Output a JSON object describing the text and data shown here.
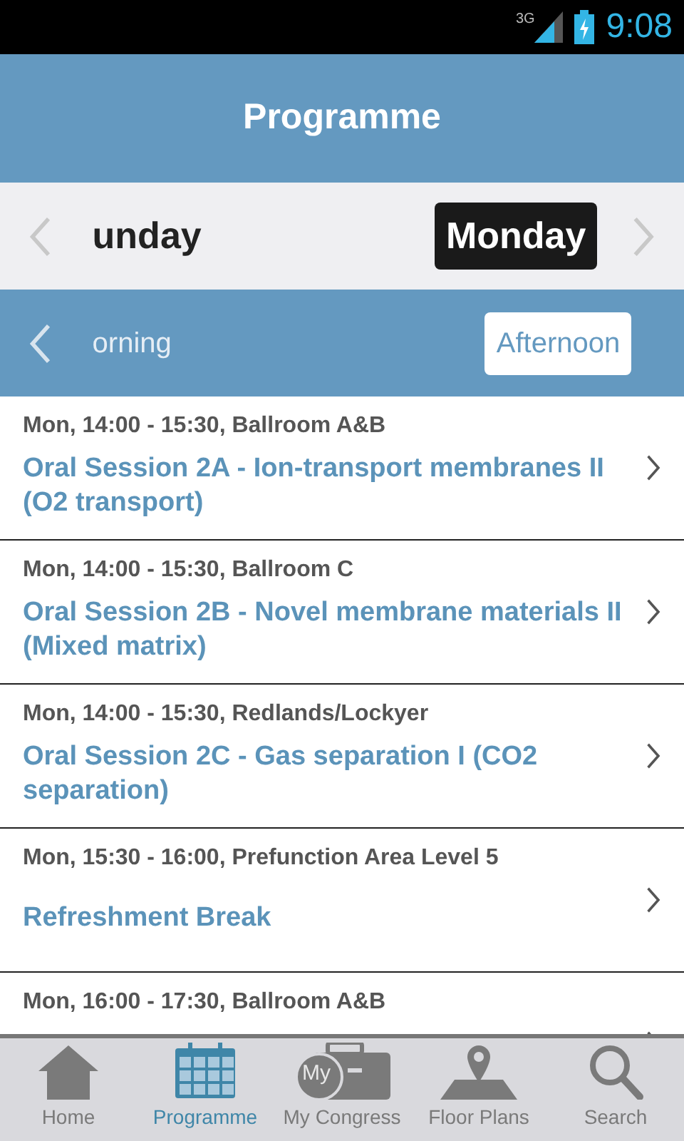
{
  "status_bar": {
    "network": "3G",
    "time": "9:08"
  },
  "header": {
    "title": "Programme"
  },
  "days": [
    {
      "label": "unday",
      "selected": false
    },
    {
      "label": "Monday",
      "selected": true
    }
  ],
  "periods": [
    {
      "label": "orning",
      "selected": false
    },
    {
      "label": "Afternoon",
      "selected": true
    }
  ],
  "sessions": [
    {
      "meta": "Mon, 14:00 - 15:30, Ballroom A&B",
      "title": "Oral Session 2A - Ion-transport membranes II (O2 transport)"
    },
    {
      "meta": "Mon, 14:00 - 15:30, Ballroom C",
      "title": "Oral Session 2B - Novel membrane materials II (Mixed matrix)"
    },
    {
      "meta": "Mon, 14:00 - 15:30, Redlands/Lockyer",
      "title": "Oral Session 2C - Gas separation I (CO2 separation)"
    },
    {
      "meta": "Mon, 15:30 - 16:00, Prefunction Area Level 5",
      "title": "Refreshment Break"
    },
    {
      "meta": "Mon, 16:00 - 17:30, Ballroom A&B"
    }
  ],
  "tabs": [
    {
      "kind": "home",
      "label": "Home",
      "selected": false
    },
    {
      "kind": "calendar",
      "label": "Programme",
      "selected": true
    },
    {
      "kind": "briefcase",
      "label": "My Congress",
      "badge": "My",
      "selected": false
    },
    {
      "kind": "map",
      "label": "Floor Plans",
      "selected": false
    },
    {
      "kind": "search",
      "label": "Search",
      "selected": false
    }
  ]
}
